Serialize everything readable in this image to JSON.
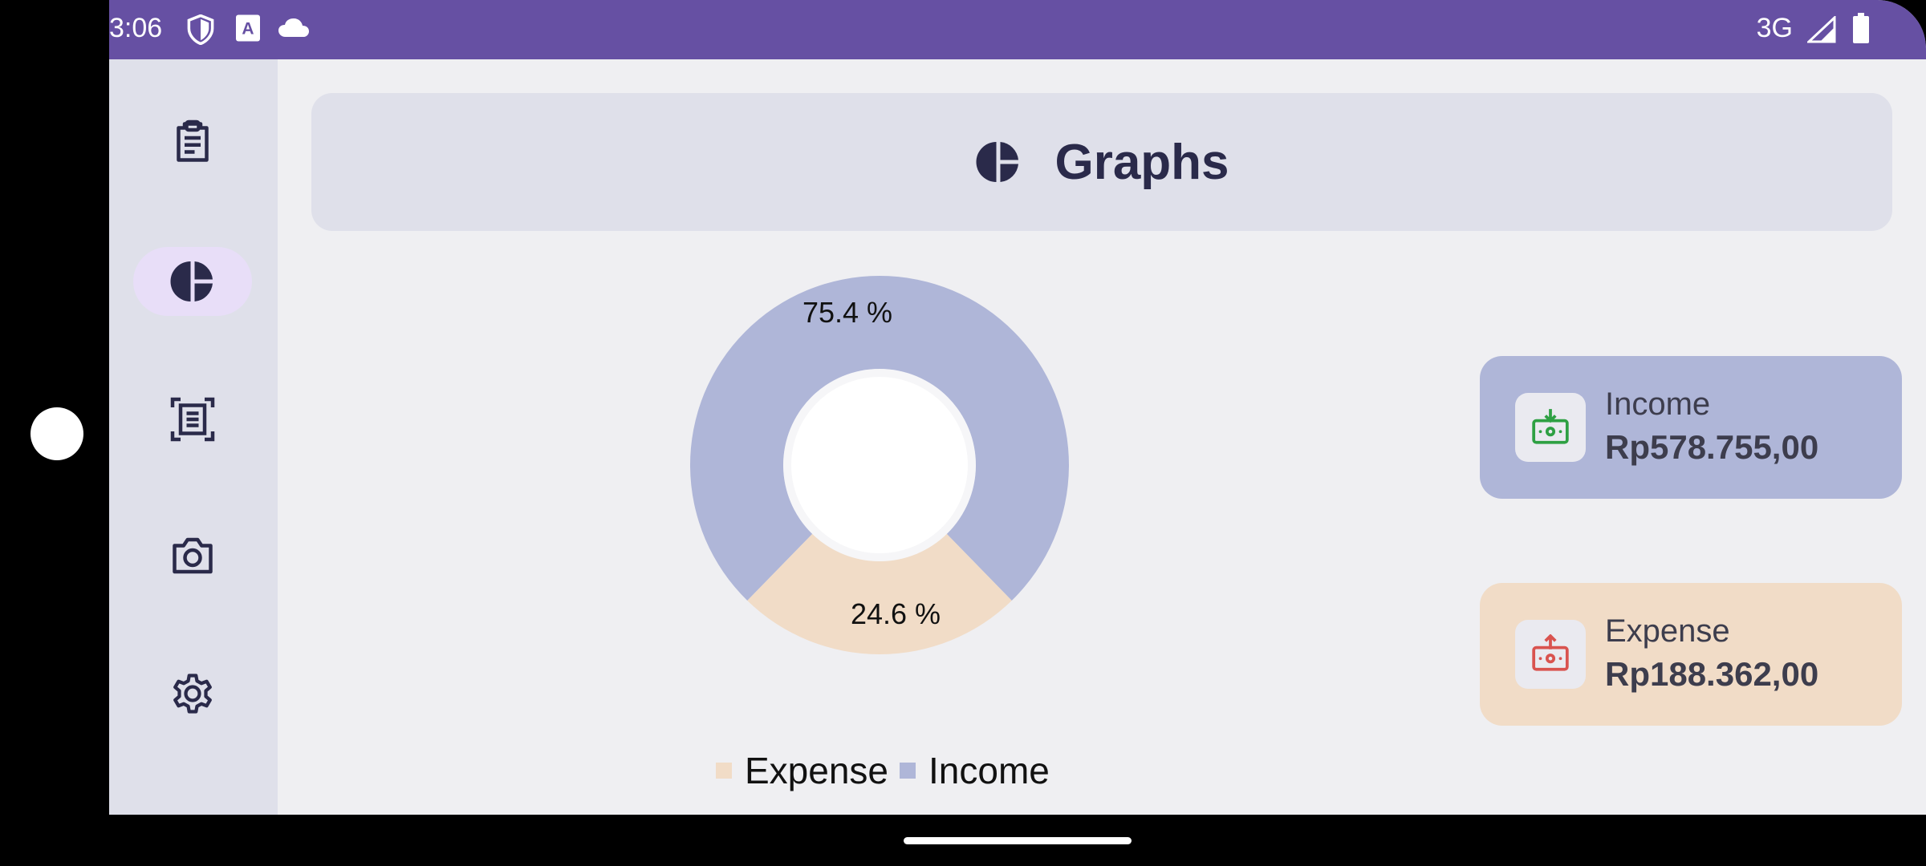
{
  "status_bar": {
    "time": "3:06",
    "network": "3G",
    "icons": [
      "shield-icon",
      "a-badge-icon",
      "cloud-icon",
      "signal-icon",
      "battery-icon"
    ]
  },
  "nav_rail": {
    "items": [
      {
        "icon": "clipboard-icon",
        "active": false
      },
      {
        "icon": "pie-chart-icon",
        "active": true
      },
      {
        "icon": "scan-document-icon",
        "active": false
      },
      {
        "icon": "camera-icon",
        "active": false
      },
      {
        "icon": "gear-icon",
        "active": false
      }
    ]
  },
  "header": {
    "icon": "pie-chart-icon",
    "title": "Graphs"
  },
  "chart_data": {
    "type": "pie",
    "categories": [
      "Income",
      "Expense"
    ],
    "values": [
      75.4,
      24.6
    ],
    "data_labels": [
      "75.4 %",
      "24.6 %"
    ],
    "colors": [
      "#afb6d8",
      "#f1dcc7"
    ],
    "legend": [
      {
        "name": "Expense",
        "color": "#f1dcc7"
      },
      {
        "name": "Income",
        "color": "#afb6d8"
      }
    ],
    "legend_placement": "bottom"
  },
  "summary": {
    "income": {
      "label": "Income",
      "value": "Rp578.755,00",
      "icon": "income-icon",
      "color": "#2ea043"
    },
    "expense": {
      "label": "Expense",
      "value": "Rp188.362,00",
      "icon": "expense-icon",
      "color": "#d9534f"
    }
  },
  "colors": {
    "status_bar": "#6650a3",
    "rail_bg": "#dfe0ea",
    "rail_active": "#e8def8",
    "icon_dark": "#2a2a4a"
  }
}
